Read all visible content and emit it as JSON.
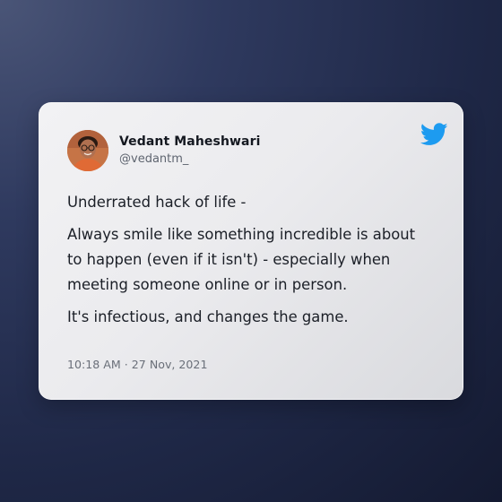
{
  "tweet": {
    "author": {
      "name": "Vedant Maheshwari",
      "handle": "@vedantm_"
    },
    "paragraphs": [
      "Underrated hack of life -",
      "Always smile like something incredible is about\nto happen (even if it isn't) - especially when\nmeeting someone online or in person.",
      "It's infectious, and changes the game."
    ],
    "timestamp": "10:18 AM · 27 Nov, 2021"
  },
  "icons": {
    "brand": "twitter-bird-icon",
    "avatar": "profile-photo"
  },
  "colors": {
    "twitter_blue": "#1d9bf0",
    "name_text": "#141820",
    "handle_text": "#5f6570",
    "body_text": "#1b1f27",
    "timestamp_text": "#6a6f79"
  }
}
